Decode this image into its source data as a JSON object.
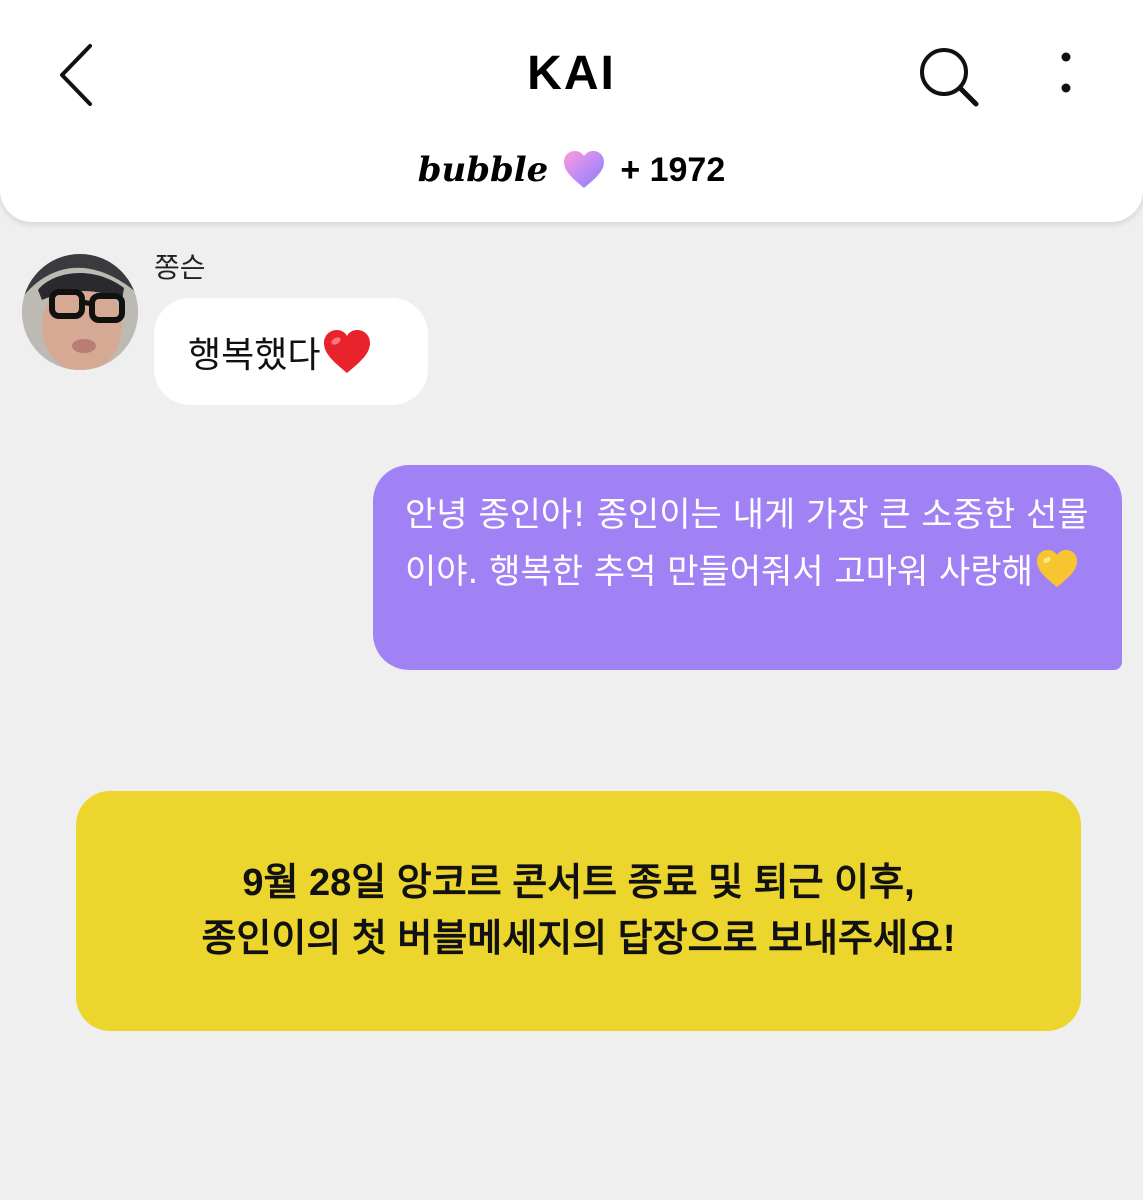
{
  "header": {
    "title": "KAI",
    "back_icon": "chevron-left-icon",
    "search_icon": "search-icon",
    "menu_icon": "more-vertical-icon",
    "bubble_logo": "bubble",
    "bubble_count": "+ 1972",
    "heart_icon": "gradient-heart-icon"
  },
  "chat": {
    "incoming": {
      "sender": "쫑슨",
      "text": "행복했다",
      "emoji": "red-heart-emoji"
    },
    "outgoing": {
      "text": "안녕 종인아! 종인이는 내게 가장 큰 소중한 선물이야. 행복한 추억 만들어줘서 고마워 사랑해",
      "emoji": "yellow-heart-emoji",
      "color": "#a182f5"
    }
  },
  "notice": {
    "line1": "9월 28일 앙코르 콘서트 종료 및 퇴근 이후,",
    "line2": "종인이의 첫 버블메세지의 답장으로 보내주세요!",
    "color": "#ecd62d"
  }
}
